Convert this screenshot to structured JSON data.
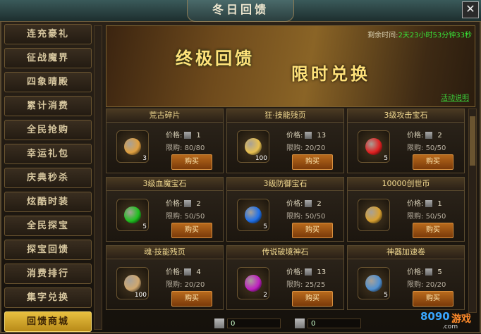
{
  "window": {
    "title": "冬日回馈",
    "close_label": "✕"
  },
  "sidebar": {
    "items": [
      {
        "label": "连充豪礼"
      },
      {
        "label": "征战魔界"
      },
      {
        "label": "四象晴殿"
      },
      {
        "label": "累计消费"
      },
      {
        "label": "全民抢购"
      },
      {
        "label": "幸运礼包"
      },
      {
        "label": "庆典秒杀"
      },
      {
        "label": "炫酷时装"
      },
      {
        "label": "全民探宝"
      },
      {
        "label": "探宝回馈"
      },
      {
        "label": "消费排行"
      },
      {
        "label": "集字兑换"
      },
      {
        "label": "回馈商城",
        "active": true
      }
    ]
  },
  "banner": {
    "headline": "终极回馈",
    "subheadline": "限时兑换",
    "timer_label": "剩余时间",
    "timer_value": "2天23小时53分钟33秒",
    "help_link": "活动说明"
  },
  "shop": {
    "price_label": "价格:",
    "limit_label": "限购:",
    "buy_label": "购买",
    "items": [
      {
        "name": "荒古碎片",
        "count": "3",
        "price": "1",
        "limit": "80/80",
        "color": "#e0a040"
      },
      {
        "name": "狂·技能残页",
        "count": "100",
        "price": "13",
        "limit": "20/20",
        "color": "#e8c050"
      },
      {
        "name": "3级攻击宝石",
        "count": "5",
        "price": "2",
        "limit": "50/50",
        "color": "#e02020"
      },
      {
        "name": "3级血魔宝石",
        "count": "5",
        "price": "2",
        "limit": "50/50",
        "color": "#20c020"
      },
      {
        "name": "3级防御宝石",
        "count": "5",
        "price": "2",
        "limit": "50/50",
        "color": "#2070e8"
      },
      {
        "name": "10000创世币",
        "count": "",
        "price": "1",
        "limit": "50/50",
        "color": "#d8a030"
      },
      {
        "name": "魂·技能残页",
        "count": "100",
        "price": "4",
        "limit": "20/20",
        "color": "#d0a870"
      },
      {
        "name": "传说破境神石",
        "count": "2",
        "price": "13",
        "limit": "25/25",
        "color": "#c020c0"
      },
      {
        "name": "神器加速卷",
        "count": "5",
        "price": "5",
        "limit": "20/20",
        "color": "#5090d0"
      }
    ]
  },
  "footer": {
    "currency1": "0",
    "currency2": "0"
  },
  "watermark": {
    "brand": "8090",
    "brand_cn": "游戏",
    "url": ".com"
  }
}
